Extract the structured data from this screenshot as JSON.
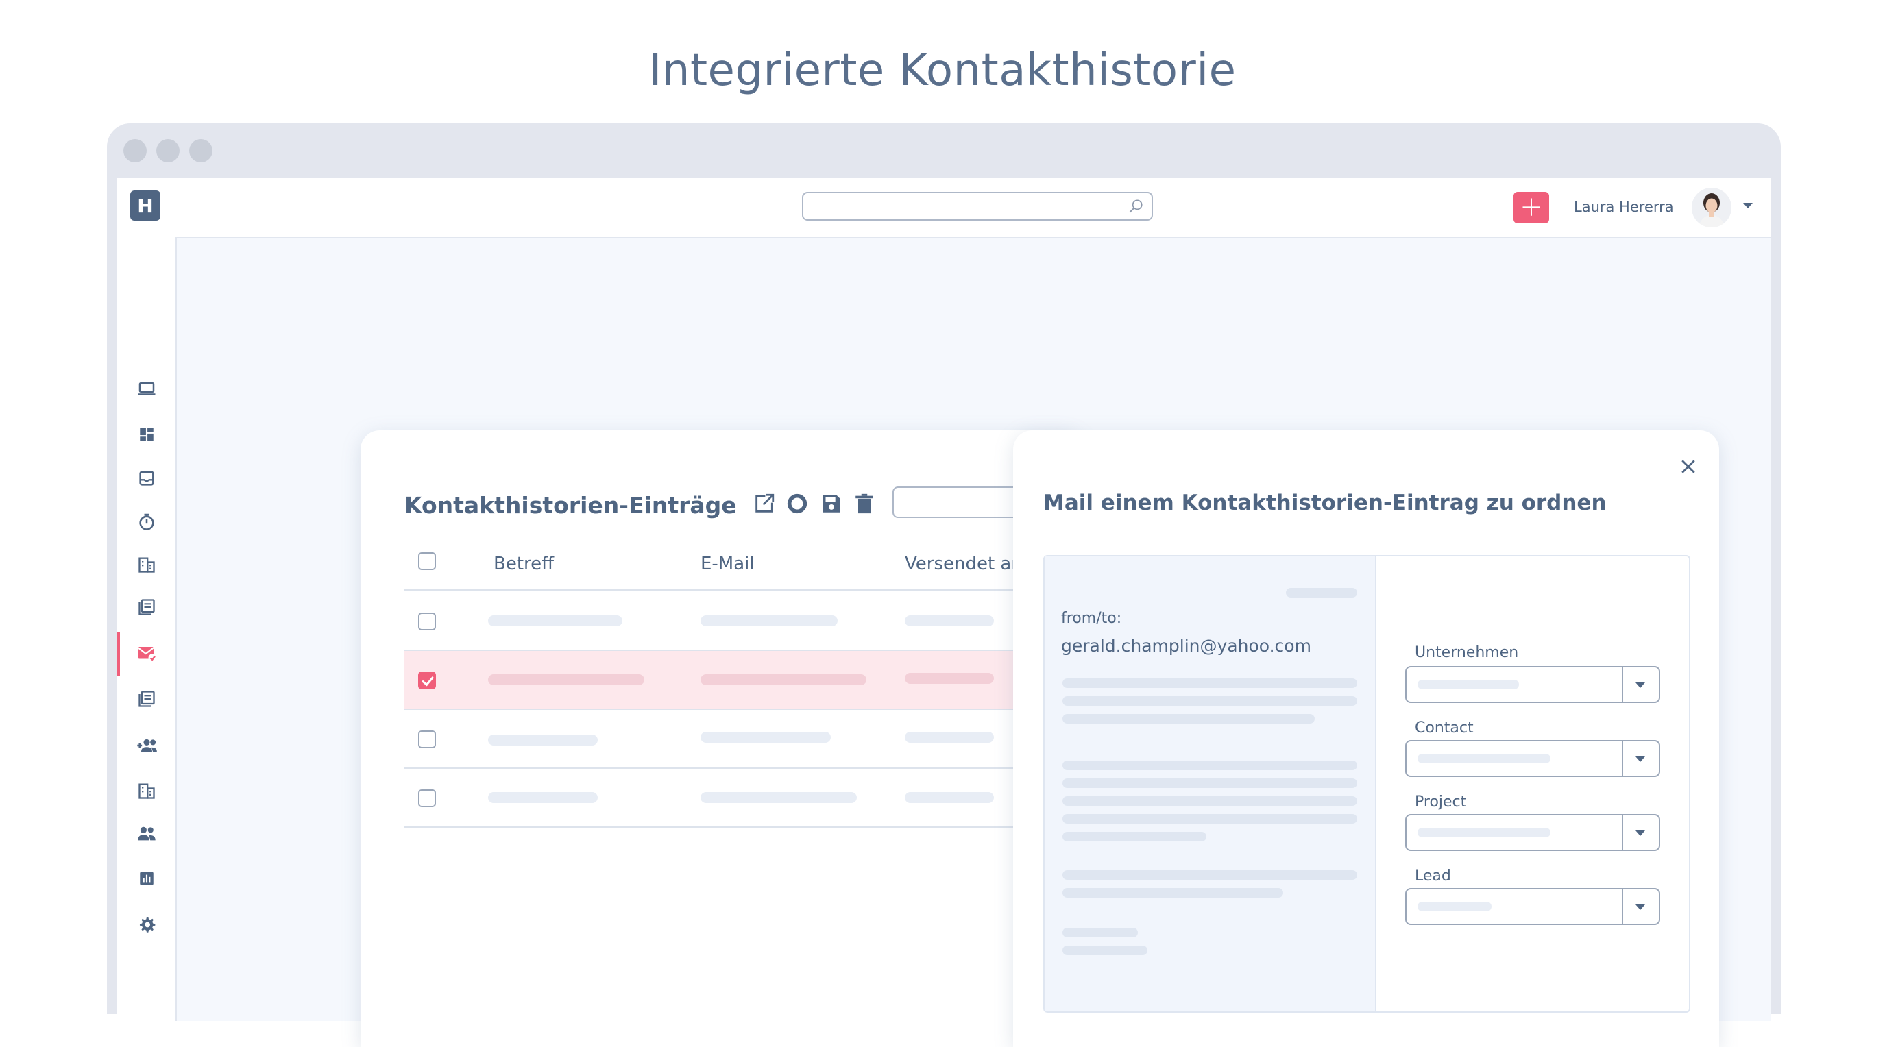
{
  "page": {
    "title": "Integrierte Kontakthistorie"
  },
  "app": {
    "logo_text": "H",
    "search_placeholder": "",
    "add_button_label": "+",
    "user_name": "Laura Hererra"
  },
  "sidebar": {
    "items": [
      {
        "icon": "laptop-icon"
      },
      {
        "icon": "dashboard-icon"
      },
      {
        "icon": "inbox-icon"
      },
      {
        "icon": "timer-icon"
      },
      {
        "icon": "building-icon"
      },
      {
        "icon": "library-icon"
      },
      {
        "icon": "mail-check-icon",
        "active": true
      },
      {
        "icon": "library-icon"
      },
      {
        "icon": "add-group-icon"
      },
      {
        "icon": "building-icon"
      },
      {
        "icon": "people-icon"
      },
      {
        "icon": "bar-chart-icon"
      },
      {
        "icon": "gear-icon"
      }
    ],
    "accent": "#f05e7a"
  },
  "list_panel": {
    "title": "Kontakthistorien-Einträge",
    "toolbar": [
      "open-external-icon",
      "circle-icon",
      "save-icon",
      "trash-icon"
    ],
    "columns": [
      "Betreff",
      "E-Mail",
      "Versendet am"
    ],
    "rows": [
      {
        "checked": false
      },
      {
        "checked": true
      },
      {
        "checked": false
      },
      {
        "checked": false
      }
    ]
  },
  "assign_panel": {
    "title": "Mail einem Kontakthistorien-Eintrag zu ordnen",
    "mail": {
      "from_label": "from/to:",
      "address": "gerald.champlin@yahoo.com"
    },
    "fields": [
      {
        "label": "Unternehmen"
      },
      {
        "label": "Contact"
      },
      {
        "label": "Project"
      },
      {
        "label": "Lead"
      }
    ]
  }
}
